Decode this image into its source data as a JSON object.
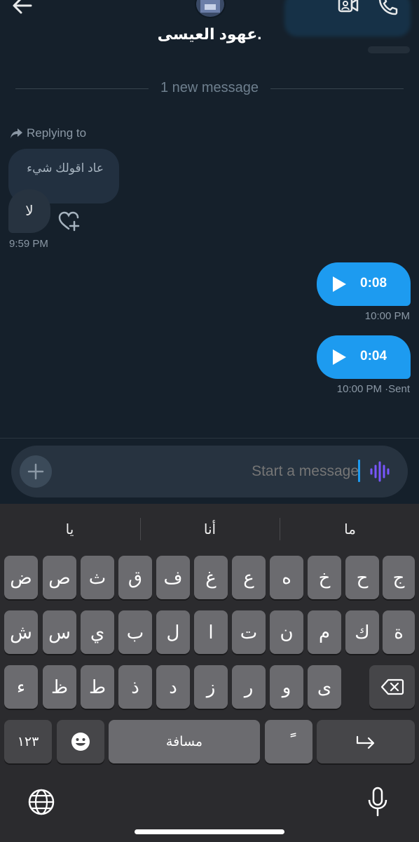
{
  "header": {
    "title": "عهود العيسى.",
    "back_icon": "arrow-left-icon",
    "video_icon": "video-call-icon",
    "call_icon": "phone-icon"
  },
  "divider": {
    "text": "1 new message"
  },
  "messages": {
    "reply_label": "Replying to",
    "reply_quote": "عاد اقولك شيء",
    "received_text": "لا",
    "received_time": "9:59 PM",
    "voice": [
      {
        "duration": "0:08",
        "time": "10:00 PM"
      },
      {
        "duration": "0:04",
        "time": "10:00 PM ·Sent"
      }
    ]
  },
  "composer": {
    "placeholder": "Start a message",
    "add_icon": "plus-icon",
    "voice_icon": "voice-wave-icon"
  },
  "keyboard": {
    "suggestions": [
      "يا",
      "أنا",
      "ما"
    ],
    "row1": [
      "ض",
      "ص",
      "ث",
      "ق",
      "ف",
      "غ",
      "ع",
      "ه",
      "خ",
      "ح",
      "ج"
    ],
    "row2": [
      "ش",
      "س",
      "ي",
      "ب",
      "ل",
      "ا",
      "ت",
      "ن",
      "م",
      "ك",
      "ة"
    ],
    "row3": [
      "ء",
      "ظ",
      "ط",
      "ذ",
      "د",
      "ز",
      "ر",
      "و",
      "ى"
    ],
    "numbers_label": "١٢٣",
    "space_label": "مسافة",
    "diacritic_label": "ًً",
    "colors": {
      "key": "#6b6b6f",
      "dark_key": "#464649",
      "accent": "#1d9bf0"
    }
  }
}
